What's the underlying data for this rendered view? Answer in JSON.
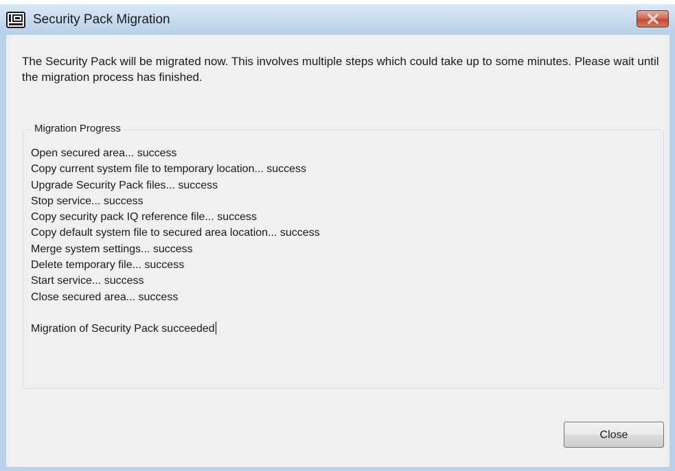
{
  "top_strip": {
    "fragment": ""
  },
  "window": {
    "title": "Security Pack Migration",
    "close_icon": "close-icon"
  },
  "intro_text": "The Security Pack will be migrated now. This involves multiple steps which could take up to some minutes. Please wait until the migration process has finished.",
  "migration_progress": {
    "legend": "Migration Progress",
    "steps": [
      "Open secured area... success",
      "Copy current system file to temporary location... success",
      "Upgrade Security Pack files... success",
      "Stop service... success",
      "Copy security pack IQ reference file... success",
      "Copy default system file to secured area location... success",
      "Merge system settings... success",
      "Delete temporary file... success",
      "Start service... success",
      "Close secured area... success"
    ],
    "final_message": "Migration of Security Pack succeeded"
  },
  "buttons": {
    "close_label": "Close"
  },
  "colors": {
    "titlebar": "#c6daee",
    "client_background": "#f0f0f0",
    "close_caption_button": "#d36b53"
  }
}
